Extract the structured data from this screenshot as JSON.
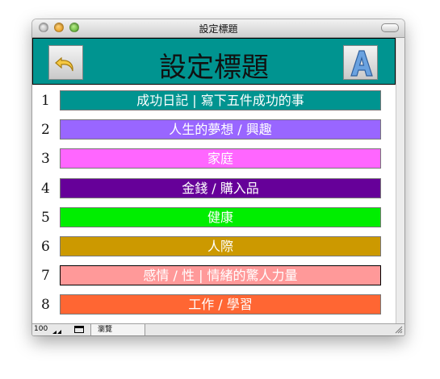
{
  "window": {
    "title": "設定標題"
  },
  "header": {
    "title": "設定標題"
  },
  "rows": [
    {
      "number": "1",
      "label": "成功日記 | 寫下五件成功的事",
      "color": "#009490"
    },
    {
      "number": "2",
      "label": "人生的夢想 / 興趣",
      "color": "#9966ff"
    },
    {
      "number": "3",
      "label": "家庭",
      "color": "#ff66ff"
    },
    {
      "number": "4",
      "label": "金錢 / 購入品",
      "color": "#660099"
    },
    {
      "number": "5",
      "label": "健康",
      "color": "#00ee00"
    },
    {
      "number": "6",
      "label": "人際",
      "color": "#cc9900"
    },
    {
      "number": "7",
      "label": "感情 / 性 | 情緒的驚人力量",
      "color": "#ff9999"
    },
    {
      "number": "8",
      "label": "工作 / 學習",
      "color": "#ff6633"
    }
  ],
  "status": {
    "zoom": "100",
    "mode": "瀏覽"
  },
  "icons": {
    "back": "back-arrow-icon",
    "font": "font-a-icon"
  }
}
